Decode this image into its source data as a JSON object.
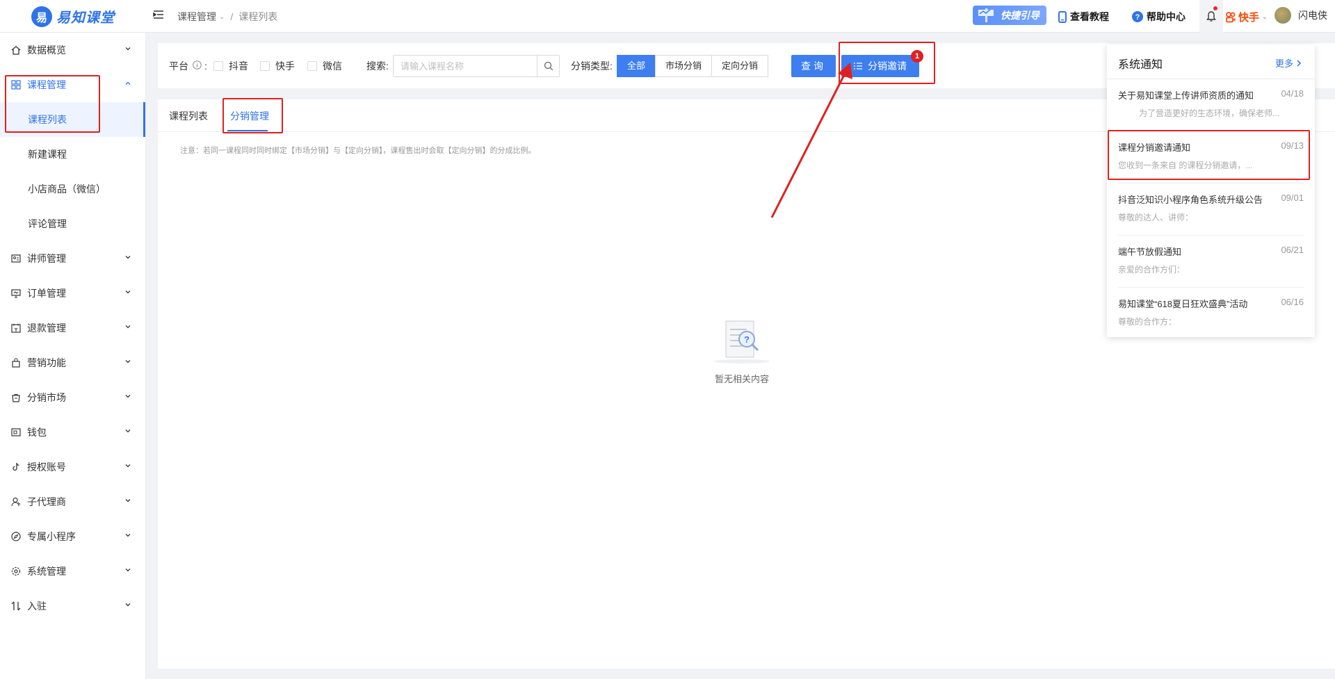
{
  "app": {
    "logo_text": "易知课堂"
  },
  "header": {
    "breadcrumb": [
      "课程管理",
      "课程列表"
    ],
    "quick_guide": "快捷引导",
    "tutorial": "查看教程",
    "help": "帮助中心",
    "platform": "快手",
    "username": "闪电侠"
  },
  "sidebar": {
    "items": [
      {
        "label": "数据概览",
        "icon": "home-icon"
      },
      {
        "label": "课程管理",
        "icon": "grid-icon",
        "expanded": true,
        "children": [
          "课程列表",
          "新建课程",
          "小店商品（微信）",
          "评论管理"
        ]
      },
      {
        "label": "讲师管理",
        "icon": "id-card-icon"
      },
      {
        "label": "订单管理",
        "icon": "monitor-icon"
      },
      {
        "label": "退款管理",
        "icon": "refund-icon"
      },
      {
        "label": "营销功能",
        "icon": "bag-icon"
      },
      {
        "label": "分销市场",
        "icon": "shop-icon"
      },
      {
        "label": "钱包",
        "icon": "wallet-icon"
      },
      {
        "label": "授权账号",
        "icon": "tiktok-icon"
      },
      {
        "label": "子代理商",
        "icon": "user-icon"
      },
      {
        "label": "专属小程序",
        "icon": "compass-icon"
      },
      {
        "label": "系统管理",
        "icon": "gear-icon"
      },
      {
        "label": "入驻",
        "icon": "swap-icon"
      }
    ]
  },
  "filters": {
    "platform_label": "平台",
    "platform_options": [
      "抖音",
      "快手",
      "微信"
    ],
    "search_label": "搜索:",
    "search_placeholder": "请输入课程名称",
    "search_value": "",
    "dist_type_label": "分销类型:",
    "dist_types": [
      "全部",
      "市场分销",
      "定向分销"
    ],
    "selected_dist_type": "全部",
    "query_button": "查询",
    "invite_button": "分销邀请",
    "invite_badge": "1"
  },
  "tabs": [
    "课程列表",
    "分销管理"
  ],
  "active_tab": "分销管理",
  "note": "注意：若同一课程同时同时绑定【市场分销】与【定向分销】，课程售出时会取【定向分销】的分成比例。",
  "empty_text": "暂无相关内容",
  "notifications": {
    "title": "系统通知",
    "more": "更多",
    "items": [
      {
        "title": "关于易知课堂上传讲师资质的通知",
        "date": "04/18",
        "summary": "为了营造更好的生态环境，确保老师..."
      },
      {
        "title": "课程分销邀请通知",
        "date": "09/13",
        "summary": "您收到一条来自        的课程分销邀请，..."
      },
      {
        "title": "抖音泛知识小程序角色系统升级公告",
        "date": "09/01",
        "summary": "尊敬的达人、讲师："
      },
      {
        "title": "端午节放假通知",
        "date": "06/21",
        "summary": "亲爱的合作方们："
      },
      {
        "title": "易知课堂“618夏日狂欢盛典”活动",
        "date": "06/16",
        "summary": "尊敬的合作方："
      }
    ]
  },
  "colors": {
    "primary": "#2f73e8",
    "annotation": "#e02020",
    "kuaishou": "#ff4906"
  }
}
